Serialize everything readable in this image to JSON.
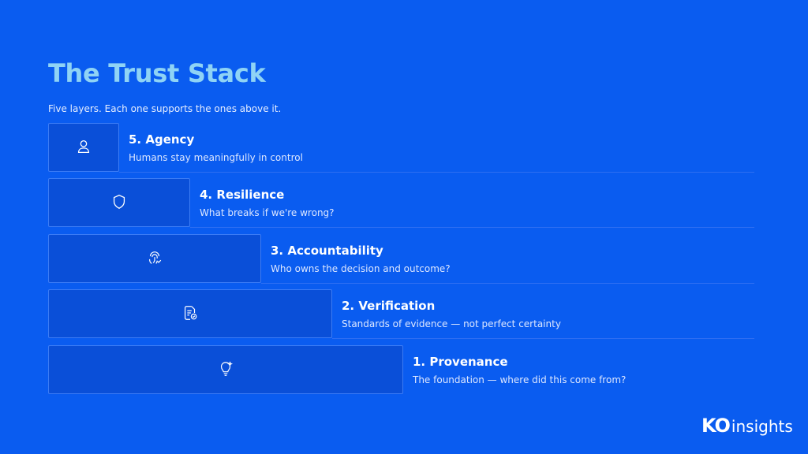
{
  "header": {
    "title": "The Trust Stack",
    "subtitle": "Five layers. Each one supports the ones above it."
  },
  "layers": [
    {
      "name": "5. Agency",
      "description": "Humans stay meaningfully in control",
      "icon": "user-icon"
    },
    {
      "name": "4. Resilience",
      "description": "What breaks if we're wrong?",
      "icon": "shield-icon"
    },
    {
      "name": "3. Accountability",
      "description": "Who owns the decision and outcome?",
      "icon": "fingerprint-icon"
    },
    {
      "name": "2. Verification",
      "description": "Standards of evidence — not perfect certainty",
      "icon": "document-check-icon"
    },
    {
      "name": "1. Provenance",
      "description": "The foundation — where did this come from?",
      "icon": "lightbulb-icon"
    }
  ],
  "logo": {
    "mark": "KO",
    "text": "insights"
  },
  "colors": {
    "background": "#0A5CF0",
    "title": "#8FD3F5",
    "box": "#0A4FD8"
  }
}
